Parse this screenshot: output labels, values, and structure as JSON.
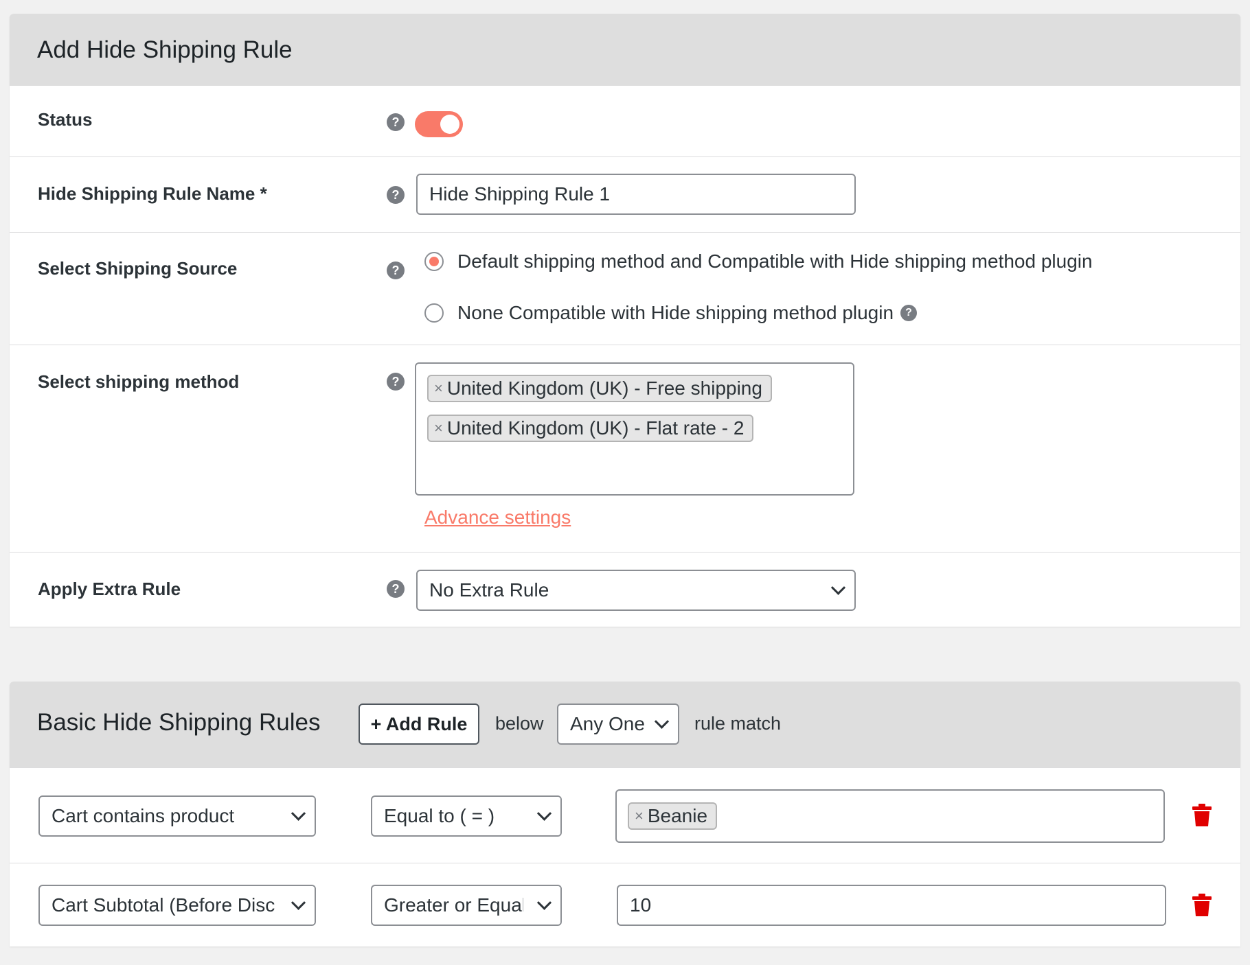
{
  "add_rule_card": {
    "title": "Add Hide Shipping Rule",
    "status": {
      "label": "Status",
      "help": "?",
      "enabled": true
    },
    "rule_name": {
      "label": "Hide Shipping Rule Name *",
      "help": "?",
      "value": "Hide Shipping Rule 1"
    },
    "shipping_source": {
      "label": "Select Shipping Source",
      "help": "?",
      "options": [
        {
          "label": "Default shipping method and Compatible with Hide shipping method plugin",
          "selected": true
        },
        {
          "label": "None Compatible with Hide shipping method plugin",
          "selected": false,
          "help": "?"
        }
      ]
    },
    "shipping_method": {
      "label": "Select shipping method",
      "help": "?",
      "tags": [
        "United Kingdom (UK) - Free shipping",
        "United Kingdom (UK) - Flat rate - 2"
      ],
      "remove_glyph": "×",
      "advance_link": "Advance settings"
    },
    "extra_rule": {
      "label": "Apply Extra Rule",
      "help": "?",
      "value": "No Extra Rule"
    }
  },
  "basic_rules_card": {
    "title": "Basic Hide Shipping Rules",
    "add_rule_button": "+ Add Rule",
    "below_text": "below",
    "match_select": "Any One",
    "rule_match_text": "rule match",
    "rules": [
      {
        "condition": "Cart contains product",
        "operator": "Equal to ( = )",
        "tag_value": "Beanie",
        "remove_glyph": "×"
      },
      {
        "condition": "Cart Subtotal (Before Disc",
        "operator": "Greater or Equal",
        "value": "10"
      }
    ]
  },
  "colors": {
    "accent": "#f97a69",
    "delete": "#e00000",
    "header_bg": "#dedede"
  },
  "icons": [
    "help-icon",
    "chevron-down-icon",
    "trash-icon",
    "close-icon"
  ]
}
